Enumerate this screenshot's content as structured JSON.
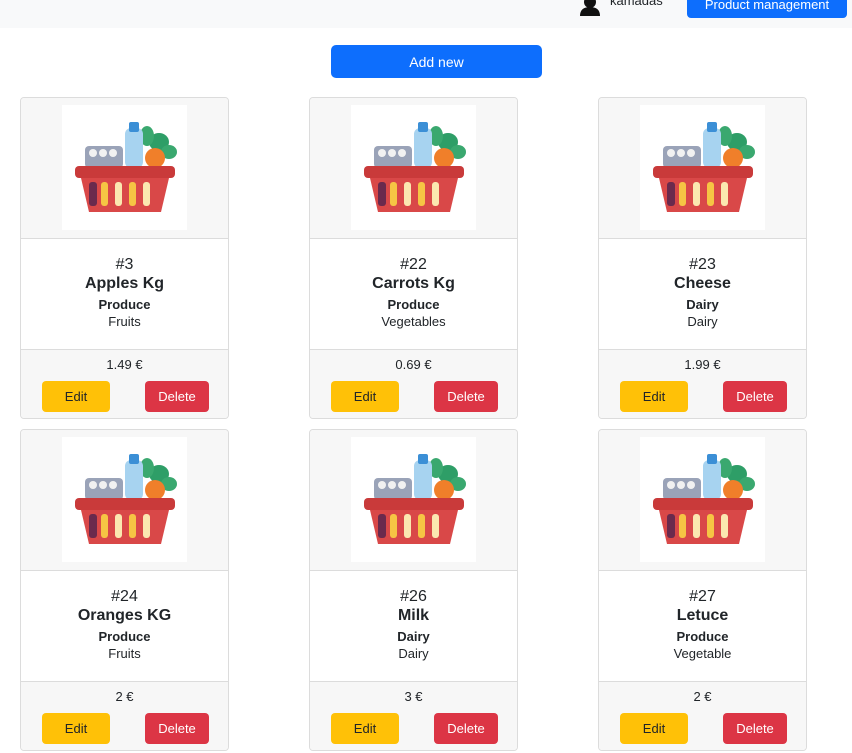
{
  "header": {
    "username": "kamadas",
    "product_management_label": "Product management"
  },
  "toolbar": {
    "add_new_label": "Add new"
  },
  "colors": {
    "primary": "#0d6efd",
    "warning": "#ffc107",
    "danger": "#dc3545"
  },
  "products": [
    {
      "id": "#3",
      "name": "Apples Kg",
      "category": "Produce",
      "subcategory": "Fruits",
      "price": "1.49 €",
      "edit": "Edit",
      "delete": "Delete",
      "image_icon": "grocery-basket-icon"
    },
    {
      "id": "#22",
      "name": "Carrots Kg",
      "category": "Produce",
      "subcategory": "Vegetables",
      "price": "0.69 €",
      "edit": "Edit",
      "delete": "Delete",
      "image_icon": "grocery-basket-icon"
    },
    {
      "id": "#23",
      "name": "Cheese",
      "category": "Dairy",
      "subcategory": "Dairy",
      "price": "1.99 €",
      "edit": "Edit",
      "delete": "Delete",
      "image_icon": "grocery-basket-icon"
    },
    {
      "id": "#24",
      "name": "Oranges KG",
      "category": "Produce",
      "subcategory": "Fruits",
      "price": "2 €",
      "edit": "Edit",
      "delete": "Delete",
      "image_icon": "grocery-basket-icon"
    },
    {
      "id": "#26",
      "name": "Milk",
      "category": "Dairy",
      "subcategory": "Dairy",
      "price": "3 €",
      "edit": "Edit",
      "delete": "Delete",
      "image_icon": "grocery-basket-icon"
    },
    {
      "id": "#27",
      "name": "Letuce",
      "category": "Produce",
      "subcategory": "Vegetable",
      "price": "2 €",
      "edit": "Edit",
      "delete": "Delete",
      "image_icon": "grocery-basket-icon"
    }
  ]
}
